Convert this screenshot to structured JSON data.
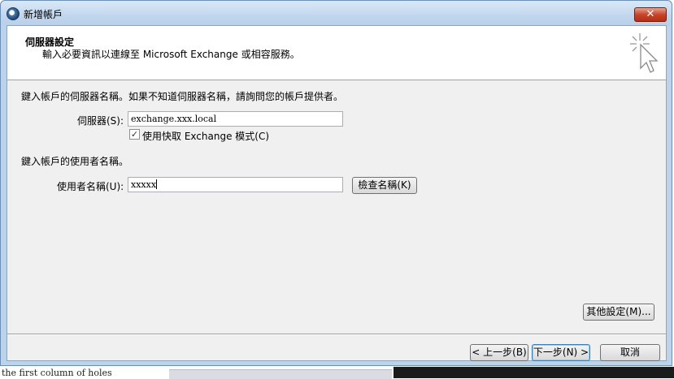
{
  "window": {
    "title": "新增帳戶"
  },
  "header": {
    "title": "伺服器設定",
    "subtitle": "輸入必要資訊以連線至 Microsoft Exchange 或相容服務。"
  },
  "server_section": {
    "instruction": "鍵入帳戶的伺服器名稱。如果不知道伺服器名稱，請詢問您的帳戶提供者。",
    "server_label": "伺服器(S):",
    "server_value": "exchange.xxx.local",
    "cached_mode_label": "使用快取 Exchange 模式(C)",
    "cached_mode_checked": true
  },
  "user_section": {
    "instruction": "鍵入帳戶的使用者名稱。",
    "username_label": "使用者名稱(U):",
    "username_value": "xxxxx",
    "check_name_button": "檢查名稱(K)"
  },
  "more_settings_button": "其他設定(M)...",
  "footer": {
    "back_button": "< 上一步(B)",
    "next_button": "下一步(N) >",
    "cancel_button": "取消"
  },
  "background": {
    "partial_text": "the first column of holes"
  },
  "colors": {
    "titlebar": "#c2d7ee",
    "close_button": "#c7452a",
    "client_bg": "#f0f0f0"
  }
}
